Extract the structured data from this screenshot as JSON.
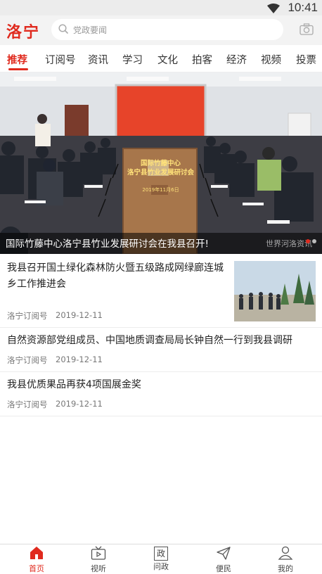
{
  "status_bar": {
    "time": "10:41"
  },
  "header": {
    "logo": "洛宁",
    "search_placeholder": "党政要闻"
  },
  "tabs": [
    {
      "label": "推荐",
      "active": true
    },
    {
      "label": "订阅号"
    },
    {
      "label": "资讯"
    },
    {
      "label": "学习"
    },
    {
      "label": "文化"
    },
    {
      "label": "拍客"
    },
    {
      "label": "经济"
    },
    {
      "label": "视频"
    },
    {
      "label": "投票"
    }
  ],
  "hero": {
    "caption": "国际竹藤中心洛宁县竹业发展研讨会在我县召开!",
    "watermark": "世界河洛资讯",
    "banner_line1": "国际竹藤中心",
    "banner_line2": "洛宁县竹业发展研讨会",
    "banner_date": "2019年11月6日"
  },
  "articles": [
    {
      "title": "我县召开国土绿化森林防火暨五级路成网绿廊连城乡工作推进会",
      "source": "洛宁订阅号",
      "date": "2019-12-11"
    },
    {
      "title": "自然资源部党组成员、中国地质调查局局长钟自然一行到我县调研",
      "source": "洛宁订阅号",
      "date": "2019-12-11"
    },
    {
      "title": "我县优质果品再获4项国展金奖",
      "source": "洛宁订阅号",
      "date": "2019-12-11"
    }
  ],
  "bottom_nav": [
    {
      "label": "首页",
      "icon": "home-icon",
      "active": true
    },
    {
      "label": "视听",
      "icon": "tv-icon"
    },
    {
      "label": "问政",
      "icon": "wenzheng-icon",
      "glyph": "政"
    },
    {
      "label": "便民",
      "icon": "send-icon"
    },
    {
      "label": "我的",
      "icon": "user-icon"
    }
  ],
  "colors": {
    "accent": "#e02a1e",
    "header_bg": "#f3f3f3"
  }
}
